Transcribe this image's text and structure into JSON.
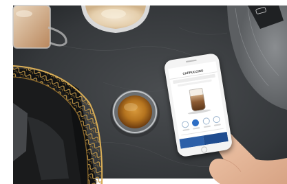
{
  "photo": {
    "subject": "espresso-table-scene",
    "colors": {
      "table": "#3b3e40",
      "espresso": "#b5741f",
      "crema": "#e8c98e",
      "gold_wire": "#b48a3e",
      "felt": "#7a7d80",
      "skin": "#e2b69a",
      "phone_body": "#f4f4f4",
      "app_accent": "#2c5fa8"
    }
  },
  "phone_app": {
    "status_text": "",
    "screen_title": "CAPPUCCINO",
    "icons": [
      "cup-icon",
      "option-icon",
      "start-button-icon"
    ]
  }
}
